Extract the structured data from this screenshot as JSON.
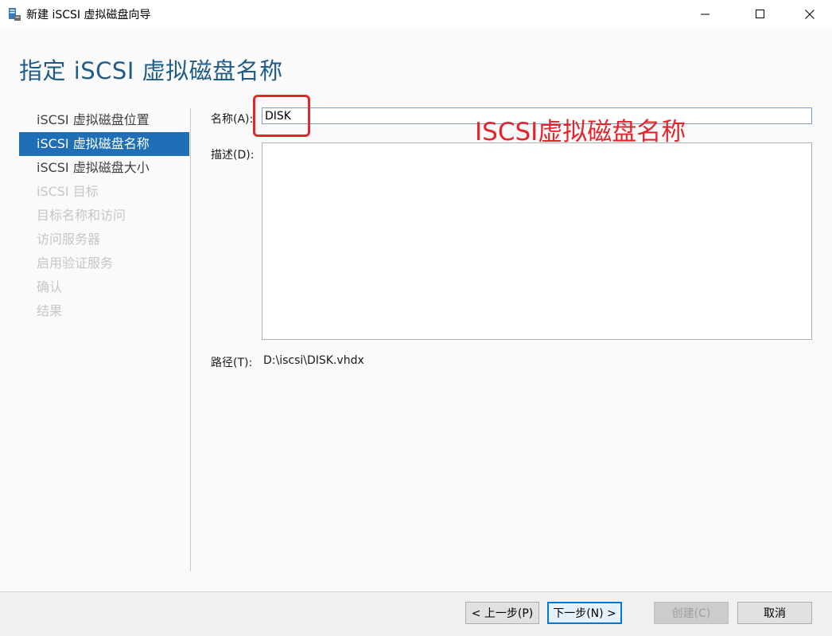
{
  "window": {
    "title": "新建 iSCSI 虚拟磁盘向导",
    "app_icon": "server-manager-icon",
    "controls": [
      "minimize-icon",
      "maximize-icon",
      "close-icon"
    ]
  },
  "page": {
    "title": "指定 iSCSI 虚拟磁盘名称"
  },
  "steps": [
    {
      "label": "iSCSI 虚拟磁盘位置",
      "state": "normal"
    },
    {
      "label": "iSCSI 虚拟磁盘名称",
      "state": "active"
    },
    {
      "label": "iSCSI 虚拟磁盘大小",
      "state": "normal"
    },
    {
      "label": "iSCSI 目标",
      "state": "disabled"
    },
    {
      "label": "目标名称和访问",
      "state": "disabled"
    },
    {
      "label": "访问服务器",
      "state": "disabled"
    },
    {
      "label": "启用验证服务",
      "state": "disabled"
    },
    {
      "label": "确认",
      "state": "disabled"
    },
    {
      "label": "结果",
      "state": "disabled"
    }
  ],
  "form": {
    "name_label": "名称(A):",
    "name_value": "DISK",
    "description_label": "描述(D):",
    "description_value": "",
    "path_label": "路径(T):",
    "path_value": "D:\\iscsi\\DISK.vhdx"
  },
  "annotation": {
    "text": "ISCSI虚拟磁盘名称",
    "color": "#e3262c"
  },
  "buttons": {
    "prev": "< 上一步(P)",
    "next": "下一步(N) >",
    "create": "创建(C)",
    "cancel": "取消"
  },
  "colors": {
    "accent": "#1e6fb5",
    "title": "#1f5c88",
    "annotation": "#e3262c"
  }
}
